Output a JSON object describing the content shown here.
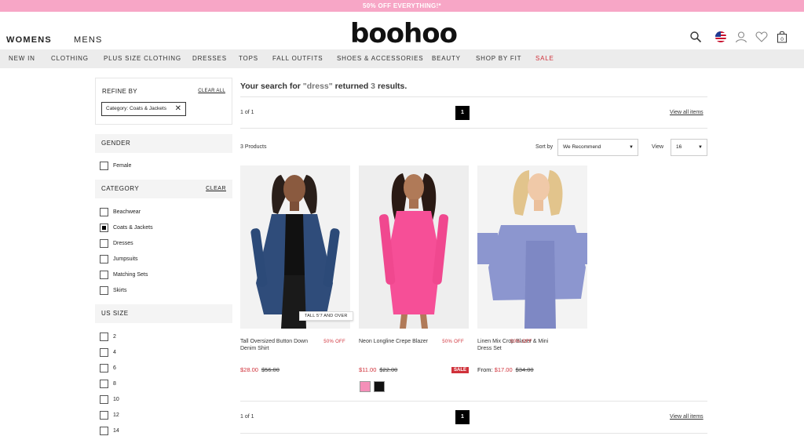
{
  "promo": {
    "text": "50% OFF EVERYTHING!*"
  },
  "header": {
    "womens": "WOMENS",
    "mens": "MENS",
    "logo": "boohoo",
    "icons": [
      "search-icon",
      "us-flag-icon",
      "account-icon",
      "heart-icon",
      "bag-icon"
    ],
    "bag_count": "0"
  },
  "nav": {
    "items": [
      "NEW IN",
      "CLOTHING",
      "PLUS SIZE CLOTHING",
      "DRESSES",
      "TOPS",
      "FALL OUTFITS",
      "SHOES & ACCESSORIES",
      "BEAUTY",
      "SHOP BY FIT",
      "SALE"
    ],
    "sale_color": "#d0313a"
  },
  "sidebar": {
    "refine_title": "REFINE BY",
    "clear_all": "CLEAR ALL",
    "chip": "Category: Coats & Jackets",
    "gender": {
      "title": "GENDER",
      "options": [
        "Female"
      ]
    },
    "category": {
      "title": "CATEGORY",
      "clear": "CLEAR",
      "options": [
        "Beachwear",
        "Coats & Jackets",
        "Dresses",
        "Jumpsuits",
        "Matching Sets",
        "Skirts"
      ],
      "selected": "Coats & Jackets"
    },
    "size": {
      "title": "US SIZE",
      "options": [
        "2",
        "4",
        "6",
        "8",
        "10",
        "12",
        "14"
      ]
    }
  },
  "main": {
    "results_prefix": "Your search for",
    "query": "\"dress\"",
    "results_mid": "returned",
    "count": "3",
    "results_suffix": "results.",
    "page_info": "1 of 1",
    "page": "1",
    "view_all": "View all items",
    "products_count": "3 Products",
    "sort_label": "Sort by",
    "sort_value": "We Recommend",
    "view_label": "View",
    "view_value": "16"
  },
  "products": [
    {
      "name": "Tall Oversized Button Down Denim Shirt",
      "discount": "50% OFF",
      "price": "$28.00",
      "was": "$56.00",
      "tag": "TALL 5'7 AND OVER"
    },
    {
      "name": "Neon Longline Crepe Blazer",
      "discount": "50% OFF",
      "price": "$11.00",
      "was": "$22.00",
      "badge": "SALE",
      "swatches": [
        "#f48fb8",
        "#111111"
      ]
    },
    {
      "name": "Linen Mix Crop Blazer & Mini Dress Set",
      "discount": "50% OFF",
      "from": "From:",
      "price": "$17.00",
      "was": "$34.00"
    }
  ],
  "colors": {
    "promo": "#f7a6c6",
    "accent": "#d0313a",
    "nav_bg": "#ececec"
  }
}
